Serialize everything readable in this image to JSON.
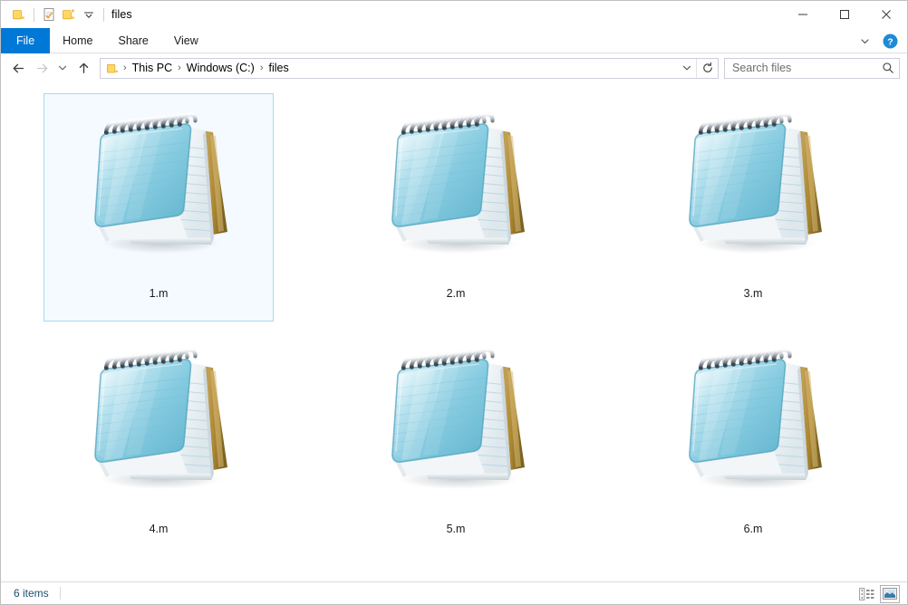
{
  "window": {
    "title": "files",
    "quick_access": [
      {
        "name": "folder-icon",
        "label": "Folder"
      },
      {
        "name": "properties-icon",
        "label": "Properties"
      },
      {
        "name": "new-folder-icon",
        "label": "New folder"
      },
      {
        "name": "chevron-down-icon",
        "label": "Customize Quick Access Toolbar"
      }
    ],
    "controls": {
      "minimize": "Minimize",
      "maximize": "Maximize",
      "close": "Close"
    }
  },
  "ribbon": {
    "tabs": [
      {
        "label": "File",
        "active": true
      },
      {
        "label": "Home",
        "active": false
      },
      {
        "label": "Share",
        "active": false
      },
      {
        "label": "View",
        "active": false
      }
    ],
    "expand_label": "Expand the Ribbon",
    "help_label": "Help"
  },
  "nav": {
    "back_label": "Back",
    "forward_label": "Forward",
    "recent_label": "Recent locations",
    "up_label": "Up",
    "breadcrumbs": [
      "This PC",
      "Windows (C:)",
      "files"
    ],
    "separator": "›",
    "dropdown_label": "Previous locations",
    "refresh_label": "Refresh"
  },
  "search": {
    "placeholder": "Search files",
    "value": ""
  },
  "files": [
    {
      "name": "1.m",
      "icon": "notepad-file-icon",
      "selected": true
    },
    {
      "name": "2.m",
      "icon": "notepad-file-icon",
      "selected": false
    },
    {
      "name": "3.m",
      "icon": "notepad-file-icon",
      "selected": false
    },
    {
      "name": "4.m",
      "icon": "notepad-file-icon",
      "selected": false
    },
    {
      "name": "5.m",
      "icon": "notepad-file-icon",
      "selected": false
    },
    {
      "name": "6.m",
      "icon": "notepad-file-icon",
      "selected": false
    }
  ],
  "status": {
    "item_count": "6 items",
    "details_view_label": "Details view",
    "large_icons_view_label": "Large icons view"
  },
  "colors": {
    "accent": "#0078d7",
    "selection_border": "#a6d9f4",
    "status_text": "#1d4f6e",
    "folder_yellow": "#ffd04b",
    "notepad_cover": "#7ec8dd",
    "notepad_back": "#b8923c"
  }
}
